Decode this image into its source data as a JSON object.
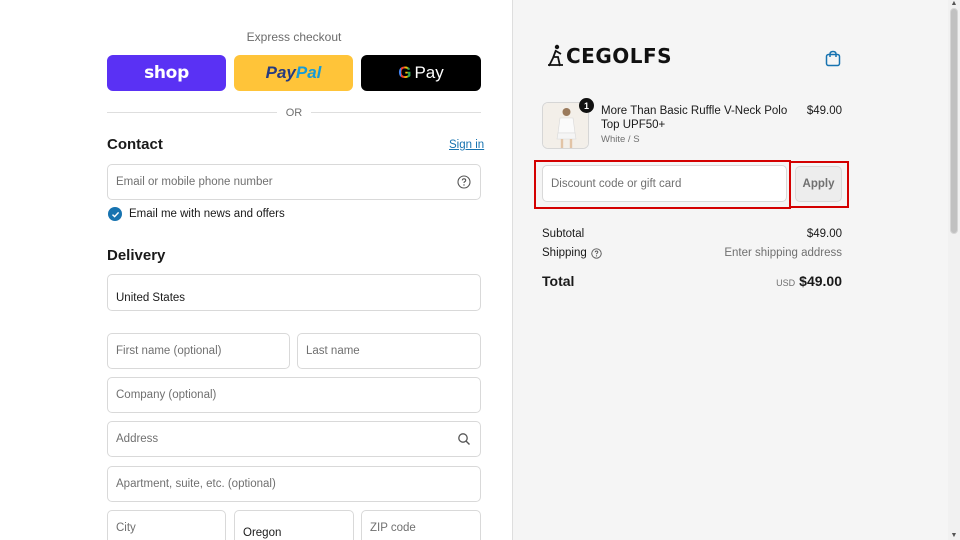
{
  "express": {
    "title": "Express checkout",
    "shop_label": "shop",
    "paypal_pay": "Pay",
    "paypal_pal": "Pal",
    "gpay_g": "G",
    "gpay_label": "Pay",
    "or_label": "OR"
  },
  "contact": {
    "title": "Contact",
    "signin_label": "Sign in",
    "email_placeholder": "Email or mobile phone number",
    "newsletter_label": "Email me with news and offers",
    "newsletter_checked": true
  },
  "delivery": {
    "title": "Delivery",
    "country_value": "United States",
    "first_name_placeholder": "First name (optional)",
    "last_name_placeholder": "Last name",
    "company_placeholder": "Company (optional)",
    "address_placeholder": "Address",
    "apartment_placeholder": "Apartment, suite, etc. (optional)",
    "city_placeholder": "City",
    "state_value": "Oregon",
    "zip_placeholder": "ZIP code"
  },
  "store": {
    "logo_text": "CEGOLFS",
    "logo_mark": "A"
  },
  "cart": {
    "item": {
      "name": "More Than Basic Ruffle V-Neck Polo Top UPF50+",
      "variant": "White / S",
      "price": "$49.00",
      "quantity": "1"
    },
    "discount_placeholder": "Discount code or gift card",
    "apply_label": "Apply",
    "subtotal_label": "Subtotal",
    "subtotal_value": "$49.00",
    "shipping_label": "Shipping",
    "shipping_value": "Enter shipping address",
    "total_label": "Total",
    "total_currency": "USD",
    "total_value": "$49.00"
  },
  "colors": {
    "shop_purple": "#5a31f4",
    "paypal_yellow": "#ffc439",
    "link_blue": "#1773b0",
    "highlight_red": "#d40000"
  }
}
